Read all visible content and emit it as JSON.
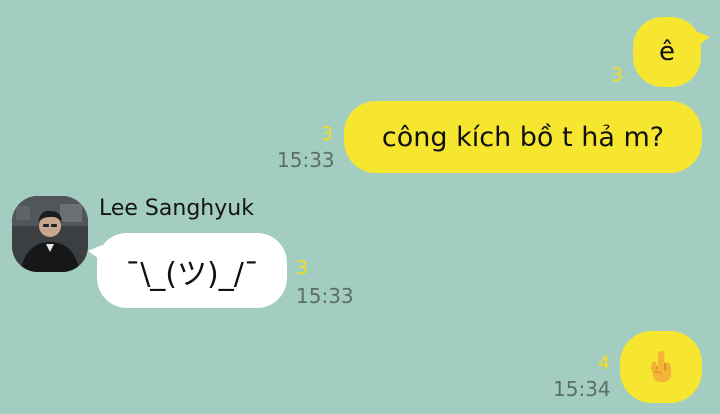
{
  "messages": [
    {
      "direction": "out",
      "text": "ê",
      "unread_count": "3",
      "time": ""
    },
    {
      "direction": "out",
      "text": "công kích bồ t hả m?",
      "unread_count": "3",
      "time": "15:33"
    },
    {
      "direction": "in",
      "sender": "Lee Sanghyuk",
      "text": "¯\\_(ツ)_/¯",
      "unread_count": "3",
      "time": "15:33"
    },
    {
      "direction": "out",
      "text": "",
      "icon": "middle-finger-emoji-icon",
      "unread_count": "4",
      "time": "15:34"
    }
  ],
  "colors": {
    "background": "#a3cdc0",
    "outgoing_bubble": "#f7e62f",
    "incoming_bubble": "#ffffff",
    "unread_count": "#f5dc1f",
    "timestamp": "#5d6e69"
  }
}
